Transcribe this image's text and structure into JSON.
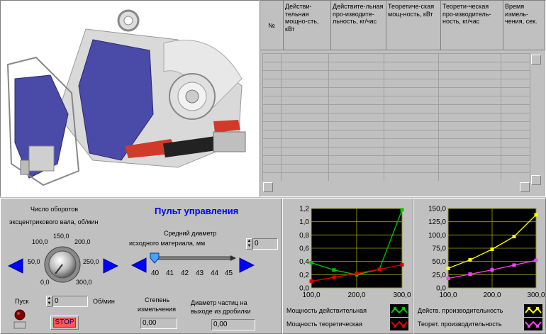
{
  "table": {
    "columns": [
      {
        "label": "№"
      },
      {
        "label": "Действи-тельная мощно-сть, кВт"
      },
      {
        "label": "Действите-льная про-изводите-льность, кг/час"
      },
      {
        "label": "Теоретиче-ская мощ-ность, кВт"
      },
      {
        "label": "Теорети-ческая про-изводитель-ность, кг/час"
      },
      {
        "label": "Время измель-чения, сек."
      }
    ]
  },
  "panel": {
    "title": "Пульт управления",
    "rpm_label_1": "Число оборотов",
    "rpm_label_2": "эксцентрикового вала, об/мин",
    "knob_ticks": [
      "0,0",
      "50,0",
      "100,0",
      "150,0",
      "200,0",
      "250,0",
      "300,0"
    ],
    "start_label": "Пуск",
    "rpm_value": "0",
    "rpm_unit": "Об/мин",
    "stop_label": "STOP",
    "diameter_label_1": "Средний диаметр",
    "diameter_label_2": "исходного материала, мм",
    "diameter_value": "0",
    "slider_ticks": [
      "40",
      "41",
      "42",
      "43",
      "44",
      "45"
    ],
    "slider_value": 40,
    "grinding_label_1": "Степень",
    "grinding_label_2": "измельчения",
    "grinding_value": "0,00",
    "particle_label_1": "Диаметр частиц на",
    "particle_label_2": "выходе из дробилки",
    "particle_value": "0,00"
  },
  "chart_data": [
    {
      "type": "line",
      "x": [
        100,
        150,
        200,
        250,
        300
      ],
      "xlim": [
        100,
        300
      ],
      "ylim": [
        0,
        1.2
      ],
      "x_ticks": [
        "100,0",
        "200,0",
        "300,0"
      ],
      "y_ticks": [
        "0,0",
        "0,2",
        "0,4",
        "0,6",
        "0,8",
        "1,0",
        "1,2"
      ],
      "grid": true,
      "series": [
        {
          "name": "Мощность действительная",
          "color": "#00c800",
          "values": [
            0.38,
            0.27,
            0.2,
            0.28,
            1.18
          ]
        },
        {
          "name": "Мощность теоретическая",
          "color": "#e00000",
          "values": [
            0.1,
            0.16,
            0.22,
            0.28,
            0.35
          ]
        }
      ]
    },
    {
      "type": "line",
      "x": [
        100,
        150,
        200,
        250,
        300
      ],
      "xlim": [
        100,
        300
      ],
      "ylim": [
        0,
        150
      ],
      "x_ticks": [
        "100,0",
        "200,0",
        "300,0"
      ],
      "y_ticks": [
        "0,0",
        "25,0",
        "50,0",
        "75,0",
        "100,0",
        "125,0",
        "150,0"
      ],
      "grid": true,
      "series": [
        {
          "name": "Действ. производительность",
          "color": "#ffff00",
          "values": [
            37,
            53,
            73,
            97,
            138
          ]
        },
        {
          "name": "Теорет. производительность",
          "color": "#ff40ff",
          "values": [
            18,
            26,
            34,
            43,
            52
          ]
        }
      ]
    }
  ],
  "colors": {
    "panel_bg": "#c0c0c0",
    "accent_blue": "#0000ff",
    "plot_bg": "#000000"
  }
}
